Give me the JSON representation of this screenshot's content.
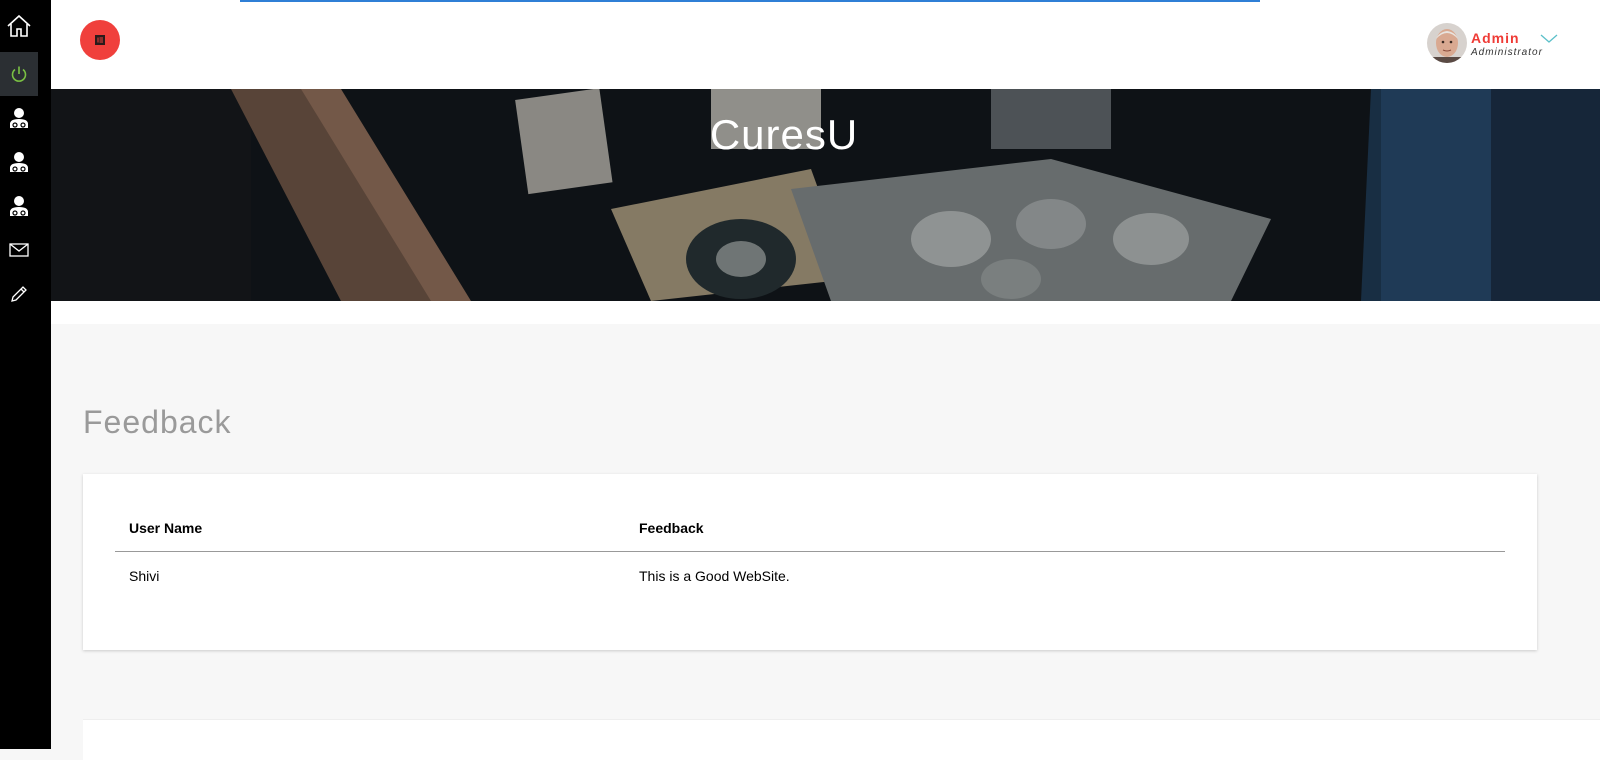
{
  "sidebar": {
    "items": [
      {
        "icon": "home-icon",
        "active": false
      },
      {
        "icon": "power-icon",
        "active": true
      },
      {
        "icon": "doctor-icon",
        "active": false
      },
      {
        "icon": "doctor-icon",
        "active": false
      },
      {
        "icon": "doctor-icon",
        "active": false
      },
      {
        "icon": "mail-icon",
        "active": false
      },
      {
        "icon": "pencil-icon",
        "active": false
      }
    ]
  },
  "header": {
    "user_name": "Admin",
    "user_role": "Administrator"
  },
  "banner": {
    "title": "CuresU"
  },
  "feedback": {
    "title": "Feedback",
    "columns": [
      "User Name",
      "Feedback"
    ],
    "rows": [
      [
        "Shivi",
        "This is a Good WebSite."
      ]
    ]
  },
  "colors": {
    "accent": "#f0403c",
    "sidebar_bg": "#000000",
    "progress": "#2f7fd6"
  }
}
